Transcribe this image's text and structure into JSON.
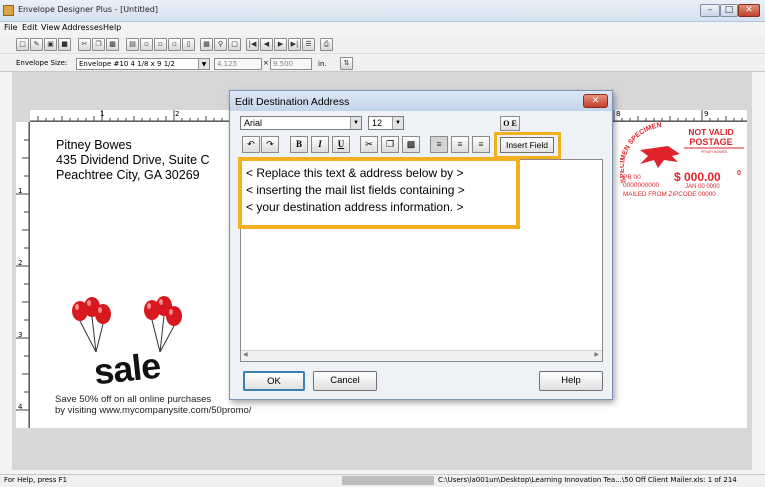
{
  "window": {
    "title": "Envelope Designer Plus - [Untitled]",
    "min_icon": "minimize-icon",
    "max_icon": "maximize-icon",
    "close_icon": "close-icon"
  },
  "menu": [
    "File",
    "Edit",
    "View",
    "Addresses",
    "Help"
  ],
  "toolbar": {
    "icons": [
      "new-icon",
      "cut-wand-icon",
      "open-icon",
      "save-icon",
      "cut-icon",
      "copy-icon",
      "paste-icon",
      "address-icon",
      "envelope-icon",
      "envelope-icon",
      "envelope-icon",
      "database-icon",
      "barcode-icon",
      "zoom-icon",
      "frame-icon",
      "first-icon",
      "prev-icon",
      "next-icon",
      "last-icon",
      "list-icon",
      "print-icon"
    ]
  },
  "props": {
    "envelope_size_label": "Envelope Size:",
    "envelope_size_value": "Envelope #10 4 1/8 x 9 1/2",
    "width_value": "4.125",
    "height_value": "9.500",
    "unit": "in."
  },
  "ruler": {
    "h_labels": [
      "1",
      "2",
      "8",
      "9"
    ],
    "v_labels": [
      "1",
      "2",
      "3",
      "4"
    ]
  },
  "envelope": {
    "return_address": [
      "Pitney Bowes",
      "435 Dividend Drive, Suite C",
      "Peachtree City, GA 30269"
    ],
    "sale_word": "sale",
    "promo_lines": [
      "Save 50% off on all online purchases",
      "by visiting www.mycompanysite.com/50promo/"
    ]
  },
  "postage": {
    "specimen": "SPECIMEN SPECIMEN",
    "not_valid": "NOT VALID",
    "postage": "POSTAGE",
    "brand": "PITNEY BOWES",
    "pb": "PB 00",
    "serial": "0000000000",
    "amount": "$ 000.00",
    "amount_sup": "0",
    "date": "JAN 00 0000",
    "mailed": "MAILED FROM ZIPCODE 00000",
    "accent": "#e0242b"
  },
  "dialog": {
    "title": "Edit Destination Address",
    "font": "Arial",
    "size": "12",
    "special_button": "O E",
    "format_buttons": [
      "undo-icon",
      "redo-icon",
      "B",
      "I",
      "U",
      "cut-icon",
      "copy-icon",
      "paste-icon",
      "align-left-icon",
      "align-center-icon",
      "align-right-icon"
    ],
    "insert_field": "Insert Field",
    "placeholder_lines": [
      "< Replace this text & address below by  >",
      "< inserting the mail list fields containing   >",
      "< your destination address information.   >"
    ],
    "ok": "OK",
    "cancel": "Cancel",
    "help": "Help",
    "highlight_color": "#f2b01e"
  },
  "status": {
    "help": "For Help, press F1",
    "file": "C:\\Users\\la001un\\Desktop\\Learning Innovation Tea...\\50 Off Client Mailer.xls: 1 of 214"
  }
}
